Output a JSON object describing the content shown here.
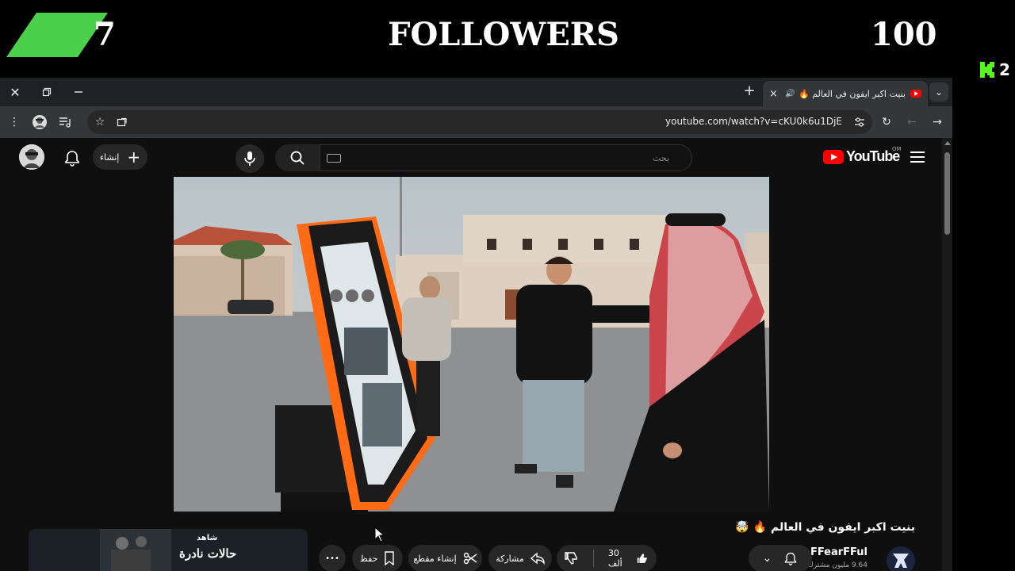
{
  "overlay": {
    "left_count": "7",
    "title": "FOLLOWERS",
    "right_count": "100",
    "kick_count": "2",
    "accent_color": "#4bd04b"
  },
  "browser": {
    "tab": {
      "title": "بنيت اكبر ايفون في العالم 🔥 |",
      "close_label": "×"
    },
    "new_tab_label": "+",
    "url": "youtube.com/watch?v=cKU0k6u1DjE"
  },
  "youtube": {
    "search_placeholder": "بحث",
    "create_label": "إنشاء",
    "logo_text": "YouTube",
    "country_code": "OM",
    "video_title": "بنيت اكبر ايفون في العالم 🔥 🤯",
    "channel_name": "FFearFFul",
    "subscribers": "9.64 مليون مشترك",
    "likes": "30 ألف",
    "share_label": "مشاركة",
    "clip_label": "إنشاء مقطع",
    "save_label": "حفظ",
    "more_label": "•••",
    "ad": {
      "brand": "شاهد",
      "title": "حالات نادرة"
    }
  },
  "icons": {
    "close": "close-icon",
    "restore": "restore-icon",
    "minimize": "minimize-icon",
    "bell": "bell-icon",
    "mic": "mic-icon",
    "search": "search-icon",
    "like": "thumbs-up-icon",
    "dislike": "thumbs-down-icon",
    "share": "share-icon",
    "clip": "scissors-icon",
    "save": "bookmark-icon"
  }
}
